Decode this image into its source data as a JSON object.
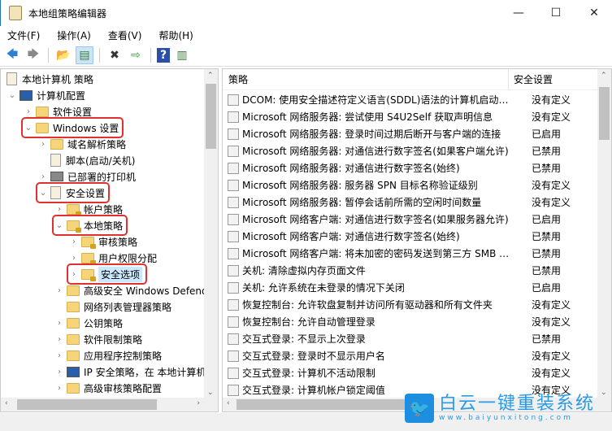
{
  "window": {
    "title": "本地组策略编辑器",
    "minimize": "—",
    "maximize": "☐",
    "close": "✕"
  },
  "menu": [
    "文件(F)",
    "操作(A)",
    "查看(V)",
    "帮助(H)"
  ],
  "toolbar": {
    "back": "🡄",
    "forward": "🡆",
    "up": "📂",
    "showhide": "▤",
    "delete": "✖",
    "export": "⇨",
    "help": "?",
    "properties": "▥"
  },
  "tree": [
    {
      "label": "本地计算机 策略",
      "level": 0,
      "icon": "doc",
      "arrow": ""
    },
    {
      "label": "计算机配置",
      "level": 1,
      "icon": "pc",
      "arrow": "⌄"
    },
    {
      "label": "软件设置",
      "level": 2,
      "icon": "folder",
      "arrow": "›"
    },
    {
      "label": "Windows 设置",
      "level": 2,
      "icon": "folder",
      "arrow": "⌄",
      "highlight": true
    },
    {
      "label": "域名解析策略",
      "level": 3,
      "icon": "folder",
      "arrow": "›"
    },
    {
      "label": "脚本(启动/关机)",
      "level": 3,
      "icon": "doc",
      "arrow": ""
    },
    {
      "label": "已部署的打印机",
      "level": 3,
      "icon": "printer",
      "arrow": "›"
    },
    {
      "label": "安全设置",
      "level": 3,
      "icon": "lockdoc",
      "arrow": "⌄",
      "highlight": true
    },
    {
      "label": "帐户策略",
      "level": 4,
      "icon": "lockfolder",
      "arrow": "›"
    },
    {
      "label": "本地策略",
      "level": 4,
      "icon": "lockfolder",
      "arrow": "⌄",
      "highlight": true
    },
    {
      "label": "审核策略",
      "level": 5,
      "icon": "lockfolder",
      "arrow": "›"
    },
    {
      "label": "用户权限分配",
      "level": 5,
      "icon": "lockfolder",
      "arrow": "›"
    },
    {
      "label": "安全选项",
      "level": 5,
      "icon": "lockfolder",
      "arrow": "›",
      "highlight": true,
      "selected": true
    },
    {
      "label": "高级安全 Windows Defender",
      "level": 4,
      "icon": "folder",
      "arrow": "›"
    },
    {
      "label": "网络列表管理器策略",
      "level": 4,
      "icon": "folder",
      "arrow": ""
    },
    {
      "label": "公钥策略",
      "level": 4,
      "icon": "folder",
      "arrow": "›"
    },
    {
      "label": "软件限制策略",
      "level": 4,
      "icon": "folder",
      "arrow": "›"
    },
    {
      "label": "应用程序控制策略",
      "level": 4,
      "icon": "folder",
      "arrow": "›"
    },
    {
      "label": "IP 安全策略，在 本地计算机",
      "level": 4,
      "icon": "pc",
      "arrow": "›"
    },
    {
      "label": "高级审核策略配置",
      "level": 4,
      "icon": "folder",
      "arrow": "›"
    }
  ],
  "policy_table": {
    "headers": [
      "策略",
      "安全设置"
    ],
    "rows": [
      [
        "DCOM: 使用安全描述符定义语言(SDDL)语法的计算机启动限制",
        "没有定义"
      ],
      [
        "Microsoft 网络服务器: 尝试使用 S4U2Self 获取声明信息",
        "没有定义"
      ],
      [
        "Microsoft 网络服务器: 登录时间过期后断开与客户端的连接",
        "已启用"
      ],
      [
        "Microsoft 网络服务器: 对通信进行数字签名(如果客户端允许)",
        "已禁用"
      ],
      [
        "Microsoft 网络服务器: 对通信进行数字签名(始终)",
        "已禁用"
      ],
      [
        "Microsoft 网络服务器: 服务器 SPN 目标名称验证级别",
        "没有定义"
      ],
      [
        "Microsoft 网络服务器: 暂停会话前所需的空闲时间数量",
        "没有定义"
      ],
      [
        "Microsoft 网络客户端: 对通信进行数字签名(如果服务器允许)",
        "已启用"
      ],
      [
        "Microsoft 网络客户端: 对通信进行数字签名(始终)",
        "已禁用"
      ],
      [
        "Microsoft 网络客户端: 将未加密的密码发送到第三方 SMB 服务器",
        "已禁用"
      ],
      [
        "关机: 清除虚拟内存页面文件",
        "已禁用"
      ],
      [
        "关机: 允许系统在未登录的情况下关闭",
        "已启用"
      ],
      [
        "恢复控制台: 允许软盘复制并访问所有驱动器和所有文件夹",
        "没有定义"
      ],
      [
        "恢复控制台: 允许自动管理登录",
        "没有定义"
      ],
      [
        "交互式登录: 不显示上次登录",
        "已禁用"
      ],
      [
        "交互式登录: 登录时不显示用户名",
        "没有定义"
      ],
      [
        "交互式登录: 计算机不活动限制",
        "没有定义"
      ],
      [
        "交互式登录: 计算机帐户锁定阈值",
        "没有定义"
      ]
    ]
  },
  "watermark": {
    "name": "白云一键重装系统",
    "url": "www.baiyunxitong.com"
  }
}
